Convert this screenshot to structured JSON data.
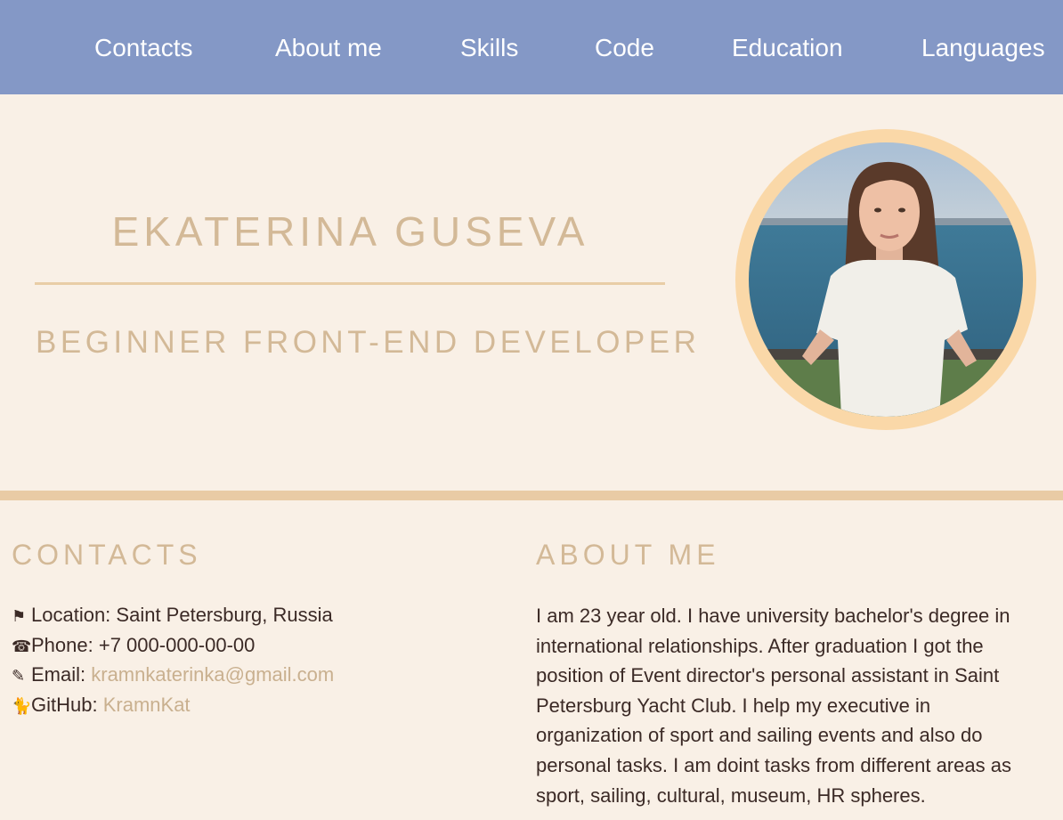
{
  "nav": {
    "items": [
      {
        "label": "Contacts"
      },
      {
        "label": "About me"
      },
      {
        "label": "Skills"
      },
      {
        "label": "Code"
      },
      {
        "label": "Education"
      },
      {
        "label": "Languages"
      }
    ]
  },
  "hero": {
    "name": "EKATERINA GUSEVA",
    "role": "BEGINNER FRONT-END DEVELOPER",
    "photo_alt": "Portrait photo"
  },
  "contacts": {
    "title": "CONTACTS",
    "location_label": "Location:",
    "location_value": "Saint Petersburg, Russia",
    "phone_label": "Phone:",
    "phone_value": "+7 000-000-00-00",
    "email_label": "Email:",
    "email_value": "kramnkaterinka@gmail.com",
    "github_label": "GitHub:",
    "github_value": "KramnKat",
    "icons": [
      "flag-icon",
      "phone-icon",
      "pencil-icon",
      "github-icon"
    ]
  },
  "about": {
    "title": "ABOUT ME",
    "text": "I am 23 year old. I have university bachelor's degree in international relationships. After graduation I got the position of Event director's personal assistant in Saint Petersburg Yacht Club. I help my executive in organization of sport and sailing events and also do personal tasks. I am doint tasks from different areas as sport, sailing, cultural, museum, HR spheres."
  },
  "colors": {
    "nav_bg": "#8498c6",
    "page_bg": "#f9f0e6",
    "accent": "#d3b997",
    "link": "#c9b08f",
    "text": "#3b2a26",
    "photo_ring": "#fad8a8"
  }
}
